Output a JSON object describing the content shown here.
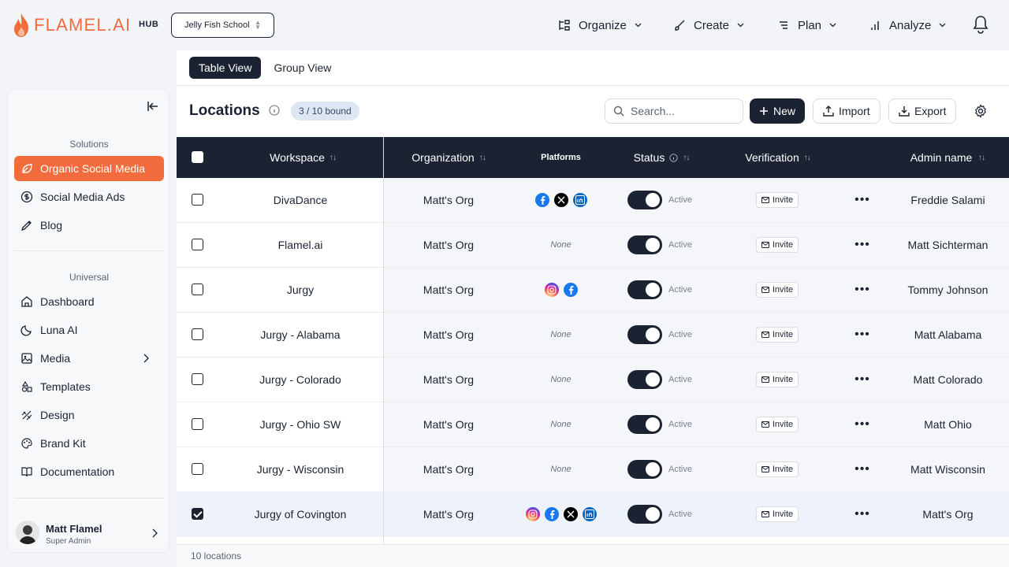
{
  "brand": {
    "name": "FLAMEL.AI",
    "hub_label": "HUB",
    "accent": "#f26c3d",
    "dark": "#1b2333"
  },
  "workspace_select": {
    "value": "Jelly Fish School"
  },
  "topnav": [
    {
      "label": "Organize",
      "icon": "organize-icon"
    },
    {
      "label": "Create",
      "icon": "brush-icon"
    },
    {
      "label": "Plan",
      "icon": "list-icon"
    },
    {
      "label": "Analyze",
      "icon": "chart-icon"
    }
  ],
  "sidebar": {
    "solutions_title": "Solutions",
    "solutions": [
      {
        "label": "Organic Social Media",
        "icon": "leaf-icon",
        "active": true
      },
      {
        "label": "Social Media Ads",
        "icon": "dollar-icon"
      },
      {
        "label": "Blog",
        "icon": "pen-icon"
      }
    ],
    "universal_title": "Universal",
    "universal": [
      {
        "label": "Dashboard",
        "icon": "home-icon"
      },
      {
        "label": "Luna AI",
        "icon": "moon-icon"
      },
      {
        "label": "Media",
        "icon": "image-icon"
      },
      {
        "label": "Templates",
        "icon": "shapes-icon"
      },
      {
        "label": "Design",
        "icon": "design-icon"
      },
      {
        "label": "Brand Kit",
        "icon": "palette-icon"
      },
      {
        "label": "Documentation",
        "icon": "book-icon"
      }
    ],
    "profile": {
      "name": "Matt Flamel",
      "role": "Super Admin"
    }
  },
  "view_tabs": [
    "Table View",
    "Group View"
  ],
  "page": {
    "title": "Locations",
    "bound_badge": "3 / 10 bound",
    "search_placeholder": "Search...",
    "new_label": "New",
    "import_label": "Import",
    "export_label": "Export"
  },
  "table": {
    "headers": {
      "workspace": "Workspace",
      "organization": "Organization",
      "platforms": "Platforms",
      "status": "Status",
      "verification": "Verification",
      "admin_name": "Admin name"
    },
    "none_label": "None",
    "status_label": "Active",
    "invite_label": "Invite",
    "rows": [
      {
        "workspace": "DivaDance",
        "organization": "Matt's Org",
        "platforms": [
          "facebook",
          "x",
          "linkedin"
        ],
        "admin": "Freddie Salami",
        "checked": false
      },
      {
        "workspace": "Flamel.ai",
        "organization": "Matt's Org",
        "platforms": [],
        "admin": "Matt Sichterman",
        "checked": false
      },
      {
        "workspace": "Jurgy",
        "organization": "Matt's Org",
        "platforms": [
          "instagram",
          "facebook"
        ],
        "admin": "Tommy Johnson",
        "checked": false
      },
      {
        "workspace": "Jurgy - Alabama",
        "organization": "Matt's Org",
        "platforms": [],
        "admin": "Matt Alabama",
        "checked": false
      },
      {
        "workspace": "Jurgy - Colorado",
        "organization": "Matt's Org",
        "platforms": [],
        "admin": "Matt Colorado",
        "checked": false
      },
      {
        "workspace": "Jurgy - Ohio SW",
        "organization": "Matt's Org",
        "platforms": [],
        "admin": "Matt Ohio",
        "checked": false
      },
      {
        "workspace": "Jurgy - Wisconsin",
        "organization": "Matt's Org",
        "platforms": [],
        "admin": "Matt Wisconsin",
        "checked": false
      },
      {
        "workspace": "Jurgy of Covington",
        "organization": "Matt's Org",
        "platforms": [
          "instagram",
          "facebook",
          "x",
          "linkedin"
        ],
        "admin": "Matt's Org",
        "checked": true
      }
    ],
    "footer": "10 locations"
  }
}
